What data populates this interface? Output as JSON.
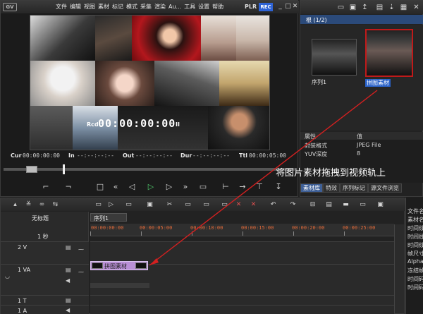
{
  "app": {
    "logo_text": "GV",
    "menu": [
      "文件",
      "编辑",
      "视图",
      "素材",
      "标记",
      "模式",
      "采集",
      "渲染",
      "Au...",
      "工具",
      "设置",
      "帮助"
    ],
    "mode_plr": "PLR",
    "mode_rec": "REC",
    "window_controls": [
      "_",
      "□",
      "✕"
    ]
  },
  "player": {
    "overlay": {
      "rcd": "Rcd",
      "timecode": "00:00:00:00",
      "pause": "II"
    },
    "timecodes": [
      {
        "label": "Cur",
        "value": "00:00:00:00"
      },
      {
        "label": "In",
        "value": "--:--:--:--"
      },
      {
        "label": "Out",
        "value": "--:--:--:--"
      },
      {
        "label": "Dur",
        "value": "--:--:--:--"
      },
      {
        "label": "Ttl",
        "value": "00:00:05:00"
      }
    ],
    "transport_icons": [
      "mark-in-icon",
      "mark-out-icon",
      "stop-icon",
      "rewind-icon",
      "step-back-icon",
      "play-icon",
      "step-forward-icon",
      "fast-forward-icon",
      "loop-icon",
      "insert-icon",
      "overwrite-icon",
      "split-icon",
      "more-icon"
    ]
  },
  "bin": {
    "folder_label": "根 (1/2)",
    "clips": [
      {
        "label": "序列1",
        "selected": false
      },
      {
        "label": "拼图素材",
        "selected": true
      }
    ],
    "properties": {
      "header_key": "属性",
      "header_val": "值",
      "rows": [
        {
          "key": "封装格式",
          "value": "JPEG File"
        },
        {
          "key": "YUV深度",
          "value": "8"
        }
      ]
    },
    "tabs": [
      "素材库",
      "特效",
      "序列标记",
      "源文件浏览"
    ]
  },
  "annotation": {
    "text": "将图片素材拖拽到视频轨上"
  },
  "timeline": {
    "title": "无标题",
    "scale": "1 秒",
    "sequence_tab": "序列1",
    "ruler": [
      "00:00:00:00",
      "00:00:05:00",
      "00:00:10:00",
      "00:00:15:00",
      "00:00:20:00",
      "00:00:25:00"
    ],
    "tracks": [
      {
        "name": "2 V"
      },
      {
        "name": "1 VA"
      },
      {
        "name": "1 T"
      },
      {
        "name": "1 A"
      }
    ],
    "clip_on_track": "拼图素材"
  },
  "side_panel": {
    "lines": [
      "文件名",
      "素材名",
      "时间线",
      "时间线",
      "时间线",
      "帧尺寸",
      "Alpha",
      "冻结帧",
      "时间码",
      "时间码"
    ]
  },
  "colors": {
    "accent_blue": "#2e63d6",
    "selection_red": "#c01a1a",
    "play_green": "#4fc86b",
    "clip_purple": "#b98fd6",
    "ruler_orange": "#e06a3a"
  }
}
